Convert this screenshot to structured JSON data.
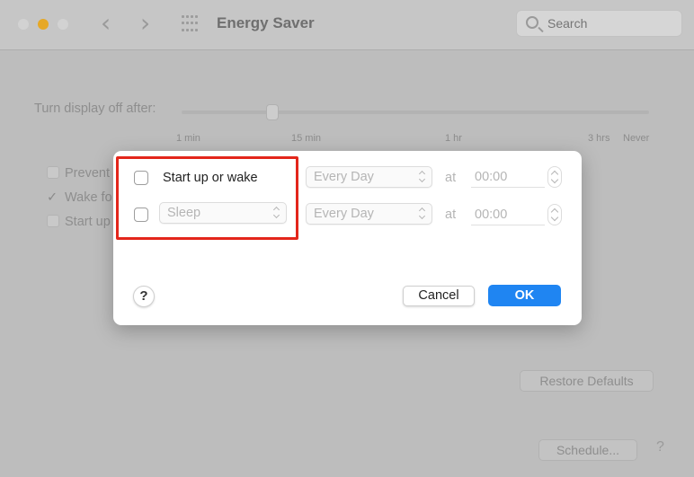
{
  "window": {
    "title": "Energy Saver",
    "search_placeholder": "Search",
    "nav_back_icon": "‹",
    "nav_forward_icon": "›"
  },
  "panel": {
    "display_off_label": "Turn display off after:",
    "ticks": [
      "1 min",
      "15 min",
      "1 hr",
      "3 hrs",
      "Never"
    ],
    "options": [
      "Prevent",
      "Wake fo",
      "Start up"
    ],
    "restore_defaults_label": "Restore Defaults",
    "schedule_label": "Schedule...",
    "help_label": "?"
  },
  "dialog": {
    "rows": [
      {
        "enabled": false,
        "event_label": "Start up or wake",
        "frequency": "Every Day",
        "at_label": "at",
        "time": "00:00"
      },
      {
        "enabled": false,
        "event_label": "Sleep",
        "frequency": "Every Day",
        "at_label": "at",
        "time": "00:00"
      }
    ],
    "help_label": "?",
    "cancel_label": "Cancel",
    "ok_label": "OK"
  },
  "colors": {
    "accent": "#1f85f2",
    "highlight": "#e3261b",
    "minimize": "#e6a826"
  }
}
